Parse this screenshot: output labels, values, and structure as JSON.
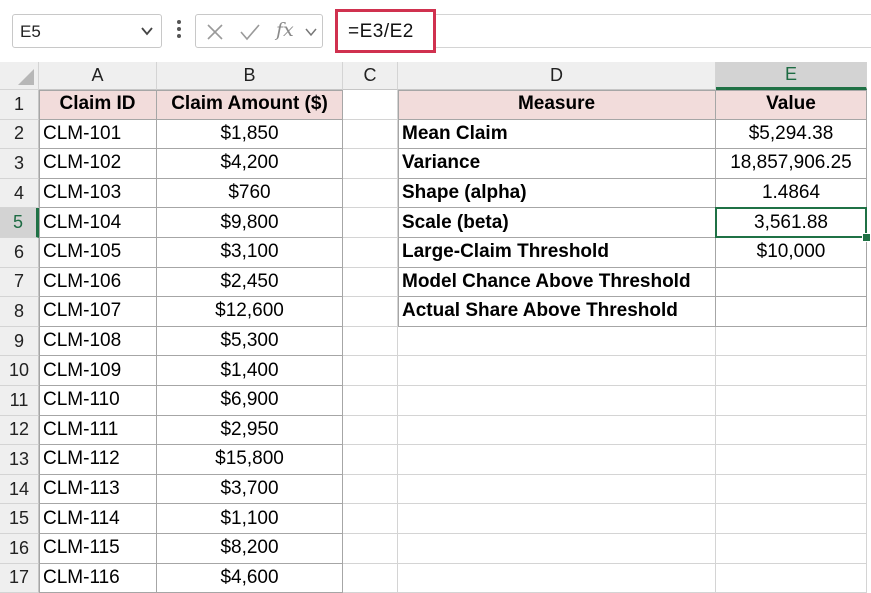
{
  "formula_bar": {
    "name_box": "E5",
    "formula": "=E3/E2",
    "fx_label": "fx",
    "icons": [
      "chevron-down-icon",
      "more-options-icon",
      "cancel-icon",
      "enter-icon",
      "function-icon"
    ]
  },
  "columns": [
    "A",
    "B",
    "C",
    "D",
    "E"
  ],
  "rows": [
    "1",
    "2",
    "3",
    "4",
    "5",
    "6",
    "7",
    "8",
    "9",
    "10",
    "11",
    "12",
    "13",
    "14",
    "15",
    "16",
    "17"
  ],
  "claims_table": {
    "headers": [
      "Claim ID",
      "Claim Amount ($)"
    ],
    "rows": [
      [
        "CLM-101",
        "$1,850"
      ],
      [
        "CLM-102",
        "$4,200"
      ],
      [
        "CLM-103",
        "$760"
      ],
      [
        "CLM-104",
        "$9,800"
      ],
      [
        "CLM-105",
        "$3,100"
      ],
      [
        "CLM-106",
        "$2,450"
      ],
      [
        "CLM-107",
        "$12,600"
      ],
      [
        "CLM-108",
        "$5,300"
      ],
      [
        "CLM-109",
        "$1,400"
      ],
      [
        "CLM-110",
        "$6,900"
      ],
      [
        "CLM-111",
        "$2,950"
      ],
      [
        "CLM-112",
        "$15,800"
      ],
      [
        "CLM-113",
        "$3,700"
      ],
      [
        "CLM-114",
        "$1,100"
      ],
      [
        "CLM-115",
        "$8,200"
      ],
      [
        "CLM-116",
        "$4,600"
      ]
    ]
  },
  "measures_table": {
    "headers": [
      "Measure",
      "Value"
    ],
    "rows": [
      [
        "Mean Claim",
        "$5,294.38"
      ],
      [
        "Variance",
        "18,857,906.25"
      ],
      [
        "Shape (alpha)",
        "1.4864"
      ],
      [
        "Scale (beta)",
        "3,561.88"
      ],
      [
        "Large-Claim Threshold",
        "$10,000"
      ],
      [
        "Model Chance Above Threshold",
        ""
      ],
      [
        "Actual Share Above Threshold",
        ""
      ]
    ]
  },
  "selection": {
    "cell": "E5",
    "column": "E",
    "row": "5"
  },
  "colors": {
    "header_fill": "#f2dcdb",
    "selection_green": "#1f7145",
    "formula_highlight": "#d0314f"
  }
}
